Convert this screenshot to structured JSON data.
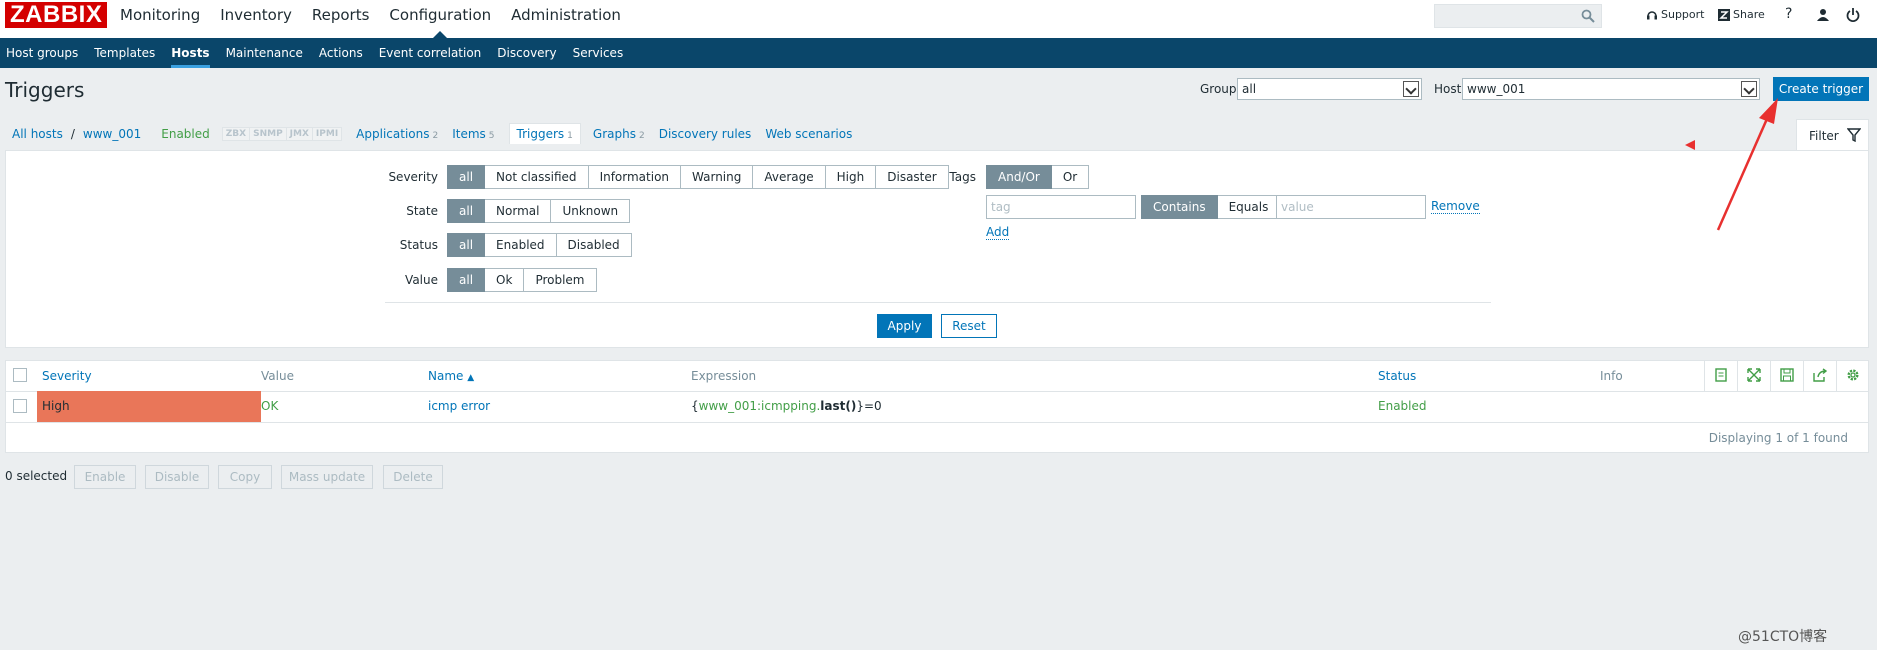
{
  "logo": "ZABBIX",
  "main_nav": [
    "Monitoring",
    "Inventory",
    "Reports",
    "Configuration",
    "Administration"
  ],
  "header_links": {
    "support": "Support",
    "share": "Share",
    "help": "?"
  },
  "sub_nav": [
    "Host groups",
    "Templates",
    "Hosts",
    "Maintenance",
    "Actions",
    "Event correlation",
    "Discovery",
    "Services"
  ],
  "page_title": "Triggers",
  "group": {
    "label": "Group",
    "value": "all"
  },
  "host": {
    "label": "Host",
    "value": "www_001"
  },
  "create_button": "Create trigger",
  "breadcrumbs": {
    "all_hosts": "All hosts",
    "sep": "/",
    "host": "www_001",
    "status": "Enabled",
    "availability": [
      "ZBX",
      "SNMP",
      "JMX",
      "IPMI"
    ],
    "tabs": [
      {
        "label": "Applications",
        "count": "2"
      },
      {
        "label": "Items",
        "count": "5"
      },
      {
        "label": "Triggers",
        "count": "1"
      },
      {
        "label": "Graphs",
        "count": "2"
      },
      {
        "label": "Discovery rules",
        "count": ""
      },
      {
        "label": "Web scenarios",
        "count": ""
      }
    ]
  },
  "filter": {
    "tab_label": "Filter",
    "severity": {
      "label": "Severity",
      "options": [
        "all",
        "Not classified",
        "Information",
        "Warning",
        "Average",
        "High",
        "Disaster"
      ]
    },
    "state": {
      "label": "State",
      "options": [
        "all",
        "Normal",
        "Unknown"
      ]
    },
    "status": {
      "label": "Status",
      "options": [
        "all",
        "Enabled",
        "Disabled"
      ]
    },
    "value": {
      "label": "Value",
      "options": [
        "all",
        "Ok",
        "Problem"
      ]
    },
    "tags": {
      "label": "Tags",
      "mode": [
        "And/Or",
        "Or"
      ],
      "tag_placeholder": "tag",
      "operator": [
        "Contains",
        "Equals"
      ],
      "value_placeholder": "value",
      "remove": "Remove",
      "add": "Add"
    },
    "apply": "Apply",
    "reset": "Reset"
  },
  "table": {
    "headers": {
      "severity": "Severity",
      "value": "Value",
      "name": "Name",
      "name_sort": "▲",
      "expression": "Expression",
      "status": "Status",
      "info": "Info"
    },
    "rows": [
      {
        "severity": "High",
        "value": "OK",
        "name": "icmp error",
        "expr_open": "{",
        "expr_item": "www_001:icmpping",
        "expr_dot": ".",
        "expr_func": "last()",
        "expr_close": "}=0",
        "status": "Enabled",
        "severity_color": "#e97659"
      }
    ],
    "displaying": "Displaying 1 of 1 found"
  },
  "footer": {
    "selected": "0 selected",
    "buttons": [
      "Enable",
      "Disable",
      "Copy",
      "Mass update",
      "Delete"
    ]
  },
  "watermark": "@51CTO博客",
  "colors": {
    "nav": "#0a466a",
    "primary": "#0275b8",
    "high": "#e97659",
    "ok": "#429e47",
    "annotation": "#e8302f"
  }
}
